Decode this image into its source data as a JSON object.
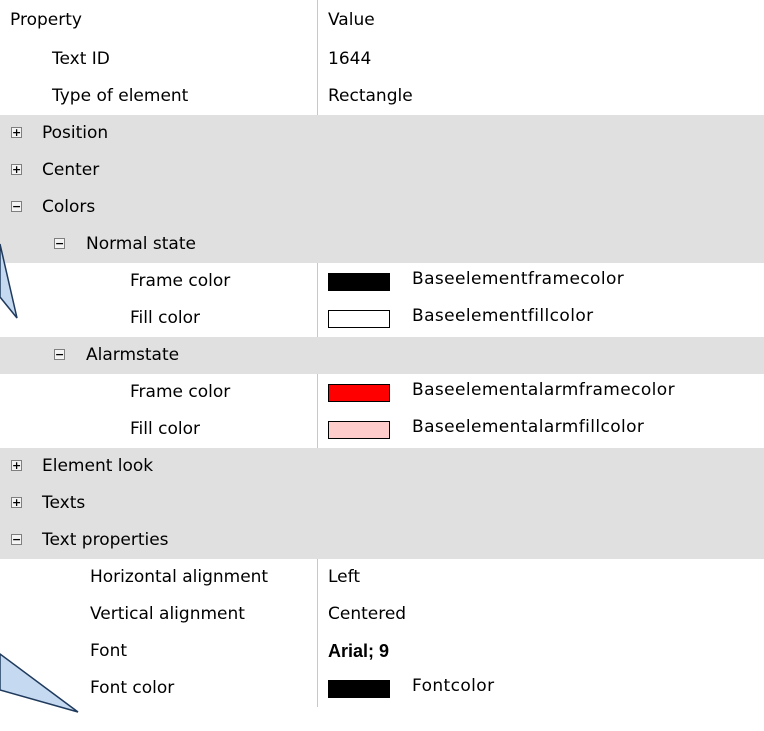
{
  "header": {
    "property": "Property",
    "value": "Value"
  },
  "rows": {
    "text_id": {
      "label": "Text ID",
      "value": "1644"
    },
    "type_of_element": {
      "label": "Type of element",
      "value": "Rectangle"
    },
    "position": {
      "label": "Position",
      "toggle": "+"
    },
    "center": {
      "label": "Center",
      "toggle": "+"
    },
    "colors": {
      "label": "Colors",
      "toggle": "−"
    },
    "normal_state": {
      "label": "Normal state",
      "toggle": "−"
    },
    "normal_frame_color": {
      "label": "Frame color",
      "value": "Baseelementframecolor",
      "swatch": "#000000"
    },
    "normal_fill_color": {
      "label": "Fill color",
      "value": "Baseelementfillcolor",
      "swatch": "#ffffff"
    },
    "alarmstate": {
      "label": "Alarmstate",
      "toggle": "−"
    },
    "alarm_frame_color": {
      "label": "Frame color",
      "value": "Baseelementalarmframecolor",
      "swatch": "#ff0000"
    },
    "alarm_fill_color": {
      "label": "Fill color",
      "value": "Baseelementalarmfillcolor",
      "swatch": "#ffcccc"
    },
    "element_look": {
      "label": "Element look",
      "toggle": "+"
    },
    "texts": {
      "label": "Texts",
      "toggle": "+"
    },
    "text_properties": {
      "label": "Text properties",
      "toggle": "−"
    },
    "horizontal_alignment": {
      "label": "Horizontal alignment",
      "value": "Left"
    },
    "vertical_alignment": {
      "label": "Vertical alignment",
      "value": "Centered"
    },
    "font": {
      "label": "Font",
      "value": "Arial; 9"
    },
    "font_color": {
      "label": "Font color",
      "value": "Fontcolor",
      "swatch": "#000000"
    }
  },
  "colors": {
    "category_background": "#e0e0e0",
    "grid_line": "#c8c8c8",
    "callout": "#c5d9f1"
  }
}
